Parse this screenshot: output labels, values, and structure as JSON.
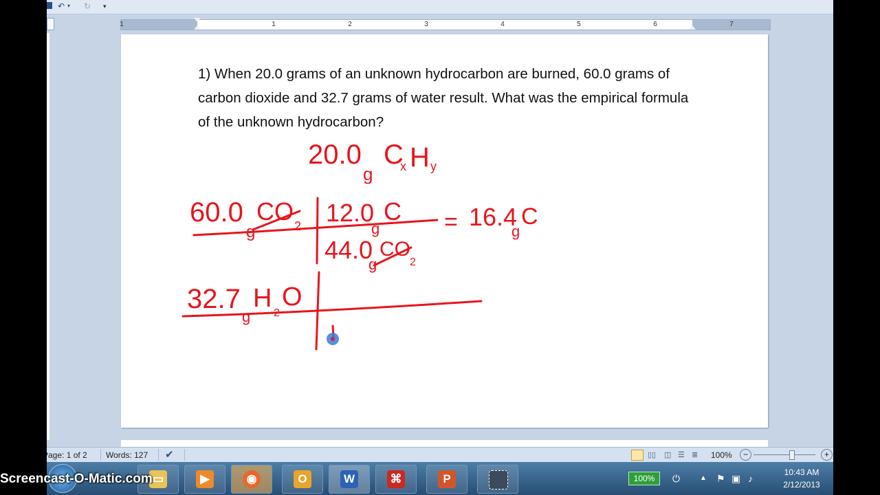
{
  "app": {
    "ruler_numbers": [
      "1",
      "1",
      "2",
      "3",
      "4",
      "5",
      "6",
      "7"
    ]
  },
  "document": {
    "question": "1) When 20.0 grams of an unknown hydrocarbon are burned, 60.0 grams of carbon dioxide and 32.7 grams of water result. What was the empirical formula of the unknown hydrocarbon?",
    "handwriting": {
      "line1": "20.0 g CxHy",
      "line2_left": "60.0 g CO2",
      "line2_num": "12.0 g C",
      "line2_den": "44.0 g CO2",
      "line2_result": "= 16.4 g C",
      "line3_left": "32.7 g H2O"
    },
    "ink_color": "#e8141c"
  },
  "status_bar": {
    "page": "Page: 1 of 2",
    "words": "Words: 127",
    "zoom": "100%",
    "zoom_minus": "−",
    "zoom_plus": "+"
  },
  "taskbar": {
    "watermark": "Screencast-O-Matic.com",
    "battery": "100%",
    "time": "10:43 AM",
    "date": "2/12/2013"
  }
}
